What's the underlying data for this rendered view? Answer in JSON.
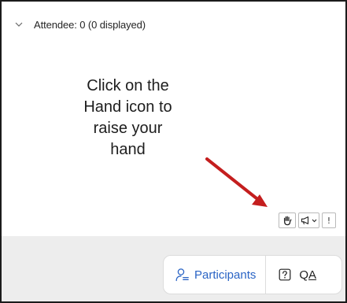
{
  "attendee_panel": {
    "header_label": "Attendee: 0 (0 displayed)"
  },
  "annotation": {
    "lines": [
      "Click on the",
      "Hand icon to",
      "raise your",
      "hand"
    ],
    "arrow_color": "#c41e1e"
  },
  "toolbar": {
    "hand_icon": "raise-hand-icon",
    "announce_icon": "megaphone-icon",
    "more_glyph": "!"
  },
  "footer": {
    "participants_label": "Participants",
    "qa_label_q": "Q",
    "qa_label_a": "A",
    "accent_color": "#2a64c5"
  }
}
